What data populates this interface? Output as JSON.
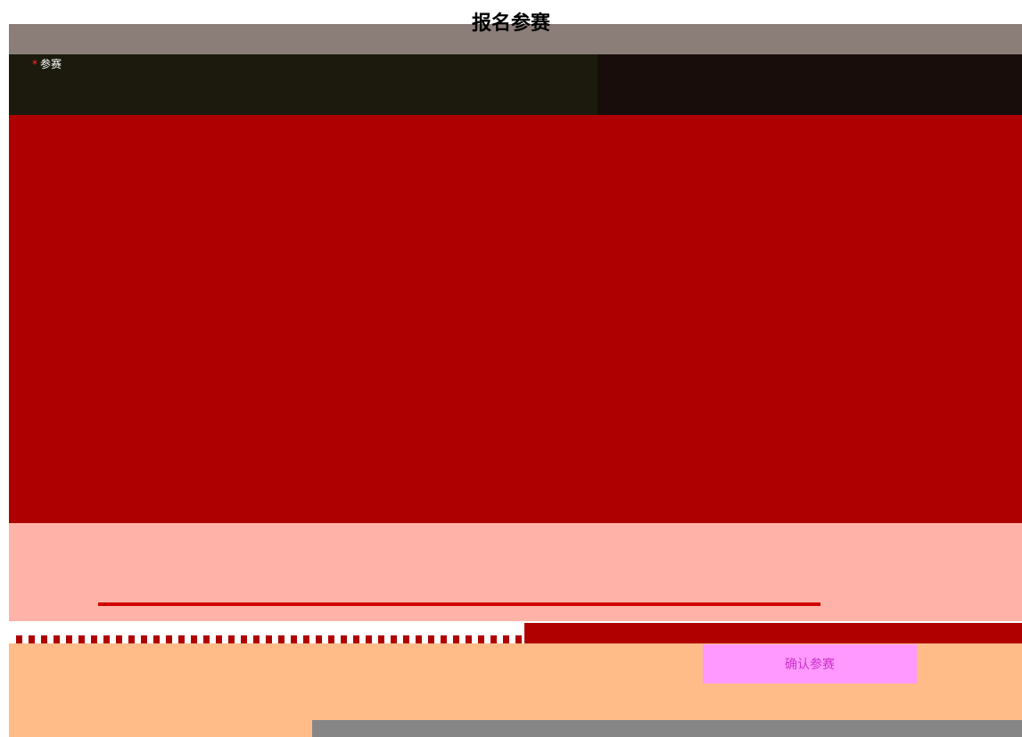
{
  "dialog": {
    "title": "报名参赛"
  },
  "form": {
    "team_label": "参赛"
  },
  "footer": {
    "confirm_label": "确认参赛"
  }
}
